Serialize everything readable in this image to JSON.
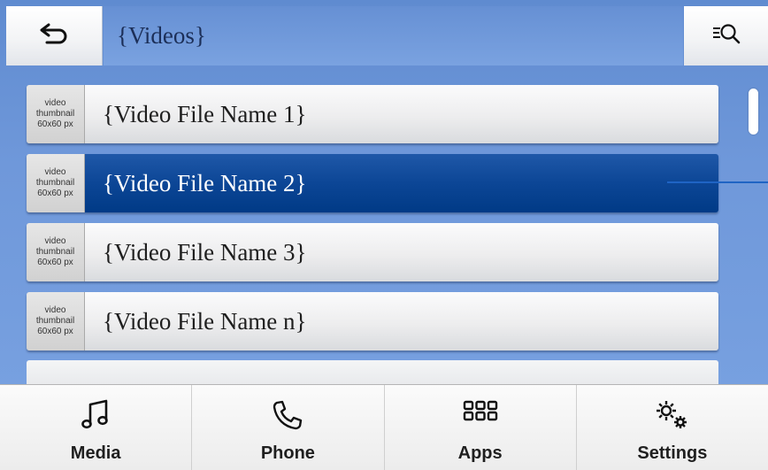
{
  "header": {
    "title": "{Videos}",
    "back_icon": "back-arrow-icon",
    "search_icon": "search-list-icon"
  },
  "list": {
    "thumbnail_text": [
      "video",
      "thumbnail",
      "60x60 px"
    ],
    "items": [
      {
        "label": "{Video File Name 1}",
        "selected": false
      },
      {
        "label": "{Video File Name 2}",
        "selected": true
      },
      {
        "label": "{Video File Name 3}",
        "selected": false
      },
      {
        "label": "{Video File Name n}",
        "selected": false
      }
    ]
  },
  "nav": {
    "items": [
      {
        "label": "Media",
        "icon": "music-note-icon"
      },
      {
        "label": "Phone",
        "icon": "phone-icon"
      },
      {
        "label": "Apps",
        "icon": "apps-grid-icon"
      },
      {
        "label": "Settings",
        "icon": "gears-icon"
      }
    ]
  },
  "colors": {
    "selected_row": "#0c4696",
    "background": "#6f98da",
    "accent_line": "#1f64c4"
  }
}
